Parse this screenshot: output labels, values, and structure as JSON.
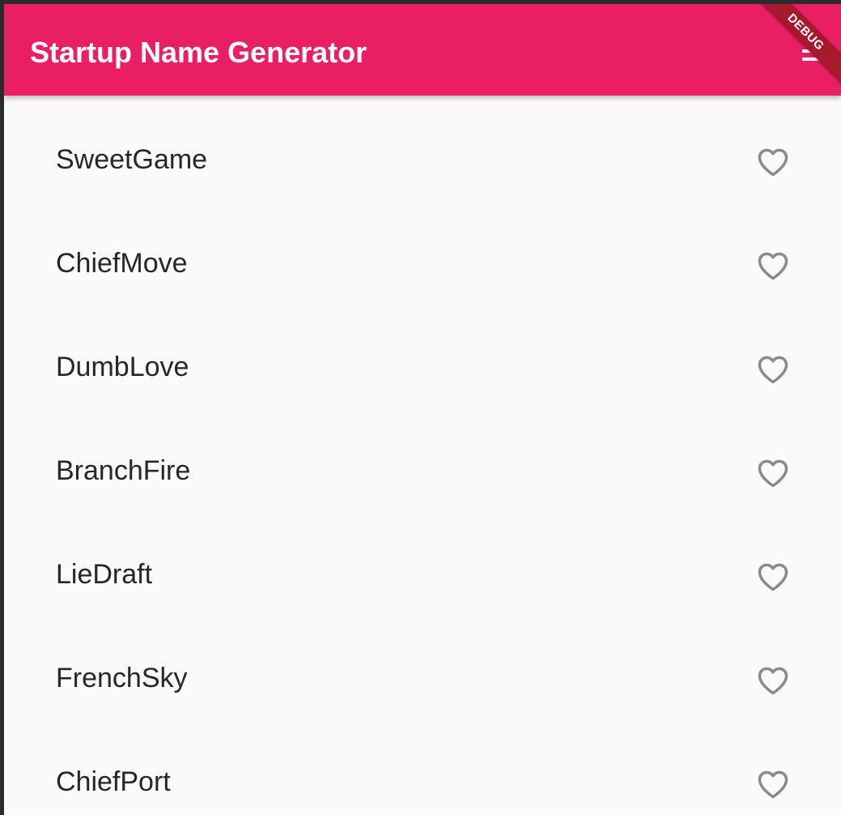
{
  "app_bar": {
    "title": "Startup Name Generator",
    "debug_label": "DEBUG",
    "background_color": "#e91e63",
    "action_icon": "list-icon"
  },
  "list": {
    "items": [
      {
        "label": "SweetGame",
        "favorite_icon": "heart-outline-icon"
      },
      {
        "label": "ChiefMove",
        "favorite_icon": "heart-outline-icon"
      },
      {
        "label": "DumbLove",
        "favorite_icon": "heart-outline-icon"
      },
      {
        "label": "BranchFire",
        "favorite_icon": "heart-outline-icon"
      },
      {
        "label": "LieDraft",
        "favorite_icon": "heart-outline-icon"
      },
      {
        "label": "FrenchSky",
        "favorite_icon": "heart-outline-icon"
      },
      {
        "label": "ChiefPort",
        "favorite_icon": "heart-outline-icon"
      }
    ],
    "icon_color": "#8a8a8a",
    "text_color": "#262626"
  }
}
